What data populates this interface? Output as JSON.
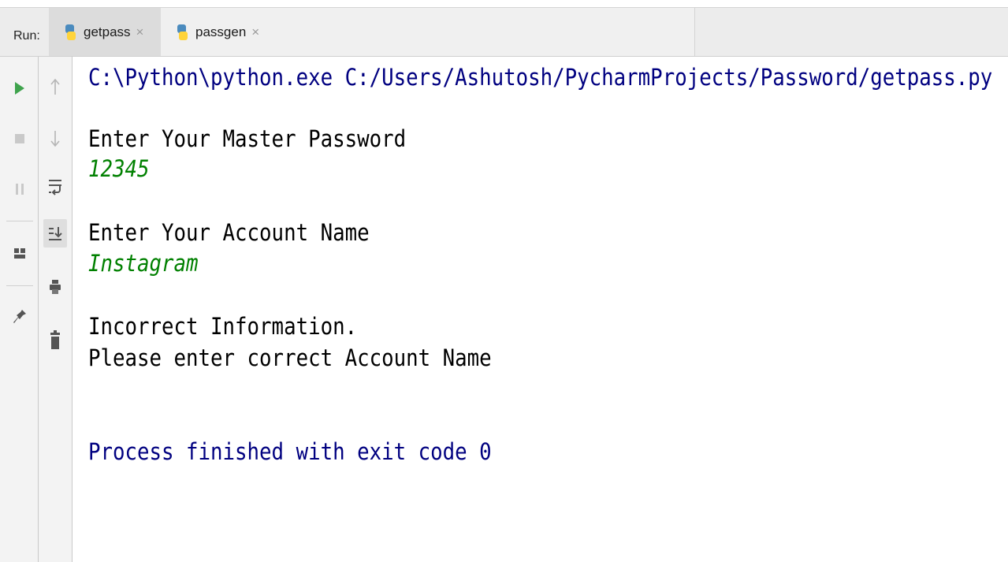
{
  "run_panel": {
    "label": "Run:",
    "tabs": [
      {
        "label": "getpass",
        "close": "×",
        "icon": "python-icon"
      },
      {
        "label": "passgen",
        "close": "×",
        "icon": "python-icon"
      }
    ]
  },
  "toolbar": {
    "left": [
      "rerun-icon",
      "stop-icon",
      "pause-icon",
      "layout-icon",
      "pin-icon"
    ],
    "right": [
      "up-arrow-icon",
      "down-arrow-icon",
      "soft-wrap-icon",
      "scroll-to-end-icon",
      "print-icon",
      "trash-icon"
    ]
  },
  "console": {
    "command": "C:\\Python\\python.exe C:/Users/Ashutosh/PycharmProjects/Password/getpass.py",
    "prompt_master": "Enter Your Master Password",
    "input_master": "12345",
    "prompt_account": "Enter Your Account Name",
    "input_account": "Instagram",
    "error_line1": "Incorrect Information.",
    "error_line2": "Please enter correct Account Name",
    "finished": "Process finished with exit code 0"
  },
  "colors": {
    "command": "#000080",
    "user_input": "#008000",
    "finished": "#000080",
    "run_green": "#3fa34d"
  }
}
